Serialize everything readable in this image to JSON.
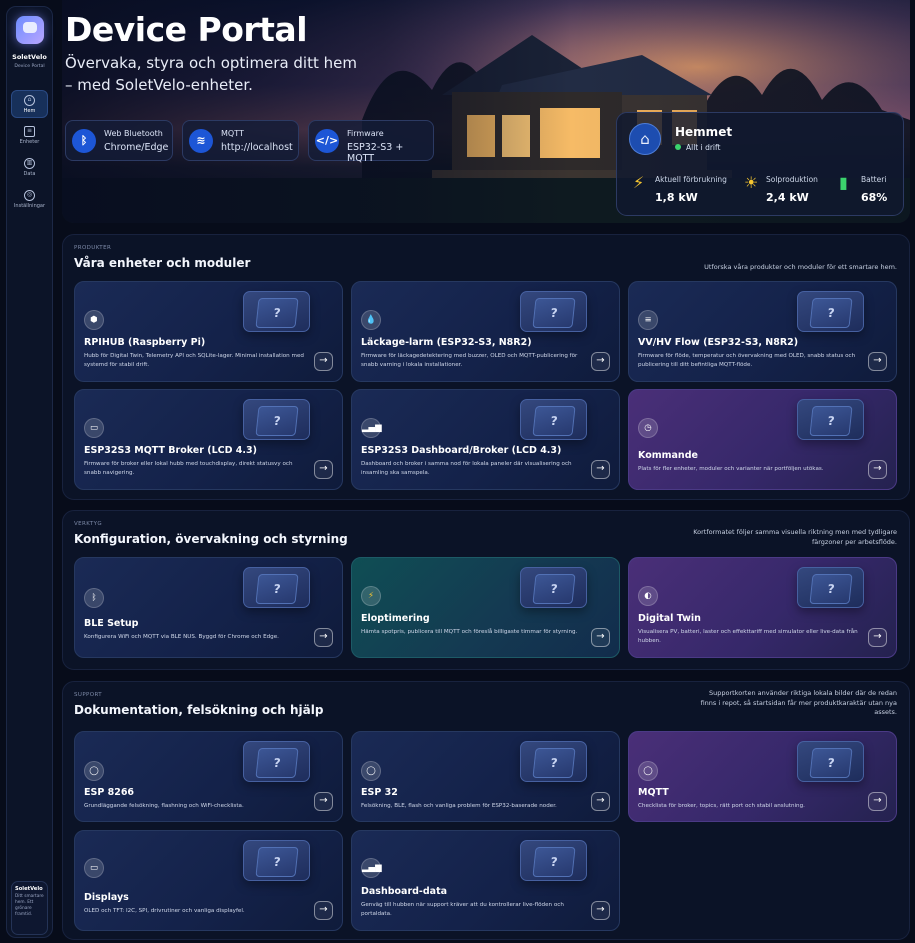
{
  "sidebar": {
    "brand": "SoletVelo",
    "brand_sub": "Device Portal",
    "nav": [
      {
        "label": "Hem",
        "icon": "home-icon",
        "active": true
      },
      {
        "label": "Enheter",
        "icon": "devices-icon",
        "active": false
      },
      {
        "label": "Data",
        "icon": "data-icon",
        "active": false
      },
      {
        "label": "Inställningar",
        "icon": "settings-icon",
        "active": false
      }
    ],
    "promo": {
      "title": "SoletVelo",
      "text": "Ditt smartare hem. Ett grönare framtid."
    }
  },
  "hero": {
    "title": "Device Portal",
    "subtitle": "Övervaka, styra och optimera ditt hem – med SoletVelo-enheter.",
    "chips": [
      {
        "label": "Web Bluetooth",
        "value": "Chrome/Edge",
        "icon": "bluetooth-icon"
      },
      {
        "label": "MQTT",
        "value": "http://localhost",
        "icon": "wifi-icon"
      },
      {
        "label": "Firmware",
        "value": "ESP32-S3 + MQTT",
        "icon": "code-icon"
      }
    ],
    "home_card": {
      "title": "Hemmet",
      "status": "Allt i drift",
      "stats": [
        {
          "label": "Aktuell förbrukning",
          "value": "1,8 kW",
          "icon": "lightning-icon"
        },
        {
          "label": "Solproduktion",
          "value": "2,4 kW",
          "icon": "sun-icon"
        },
        {
          "label": "Batteri",
          "value": "68%",
          "icon": "battery-icon"
        }
      ]
    }
  },
  "sections": {
    "products": {
      "kicker": "PRODUKTER",
      "title": "Våra enheter och moduler",
      "description": "Utforska våra produkter och moduler för ett smartare hem.",
      "cards": [
        {
          "title": "RPIHUB (Raspberry Pi)",
          "description": "Hubb för Digital Twin, Telemetry API och SQLite-lager. Minimal installation med systemd för stabil drift.",
          "icon": "chip-icon",
          "style": "blue"
        },
        {
          "title": "Läckage-larm (ESP32-S3, N8R2)",
          "description": "Firmware för läckagedetektering med buzzer, OLED och MQTT-publicering för snabb varning i lokala installationer.",
          "icon": "water-drop-icon",
          "style": "blue"
        },
        {
          "title": "VV/HV Flow (ESP32-S3, N8R2)",
          "description": "Firmware för flöde, temperatur och övervakning med OLED, snabb status och publicering till ditt befintliga MQTT-flöde.",
          "icon": "flow-icon",
          "style": "blue"
        },
        {
          "title": "ESP32S3 MQTT Broker (LCD 4.3)",
          "description": "Firmware för broker eller lokal hubb med touchdisplay, direkt statusvy och snabb navigering.",
          "icon": "monitor-icon",
          "style": "blue"
        },
        {
          "title": "ESP32S3 Dashboard/Broker (LCD 4.3)",
          "description": "Dashboard och broker i samma nod för lokala paneler där visualisering och insamling ska samspela.",
          "icon": "signal-bars-icon",
          "style": "blue"
        },
        {
          "title": "Kommande",
          "description": "Plats för fler enheter, moduler och varianter när portföljen utökas.",
          "icon": "clock-icon",
          "style": "purple"
        }
      ]
    },
    "tools": {
      "kicker": "VERKTYG",
      "title": "Konfiguration, övervakning och styrning",
      "description": "Kortformatet följer samma visuella riktning men med tydligare färgzoner per arbetsflöde.",
      "cards": [
        {
          "title": "BLE Setup",
          "description": "Konfigurera WiFi och MQTT via BLE NUS. Byggd för Chrome och Edge.",
          "icon": "bluetooth-icon",
          "style": "blue"
        },
        {
          "title": "Eloptimering",
          "description": "Hämta spotpris, publicera till MQTT och föreslå billigaste timmar för styrning.",
          "icon": "lightning-icon",
          "style": "cyan"
        },
        {
          "title": "Digital Twin",
          "description": "Visualisera PV, batteri, laster och effekttariff med simulator eller live-data från hubben.",
          "icon": "toggle-icon",
          "style": "purple"
        }
      ]
    },
    "support": {
      "kicker": "SUPPORT",
      "title": "Dokumentation, felsökning och hjälp",
      "description": "Supportkorten använder riktiga lokala bilder där de redan finns i repot, så startsidan får mer produktkaraktär utan nya assets.",
      "cards": [
        {
          "title": "ESP 8266",
          "description": "Grundläggande felsökning, flashning och WiFi-checklista.",
          "icon": "help-icon",
          "style": "blue"
        },
        {
          "title": "ESP 32",
          "description": "Felsökning, BLE, flash och vanliga problem för ESP32-baserade noder.",
          "icon": "help-icon",
          "style": "blue"
        },
        {
          "title": "MQTT",
          "description": "Checklista för broker, topics, rätt port och stabil anslutning.",
          "icon": "help-icon",
          "style": "purple"
        },
        {
          "title": "Displays",
          "description": "OLED och TFT: I2C, SPI, drivrutiner och vanliga displayfel.",
          "icon": "monitor-icon",
          "style": "blue"
        },
        {
          "title": "Dashboard-data",
          "description": "Genväg till hubben när support kräver att du kontrollerar live-flöden och portaldata.",
          "icon": "signal-bars-icon",
          "style": "blue"
        }
      ]
    }
  }
}
